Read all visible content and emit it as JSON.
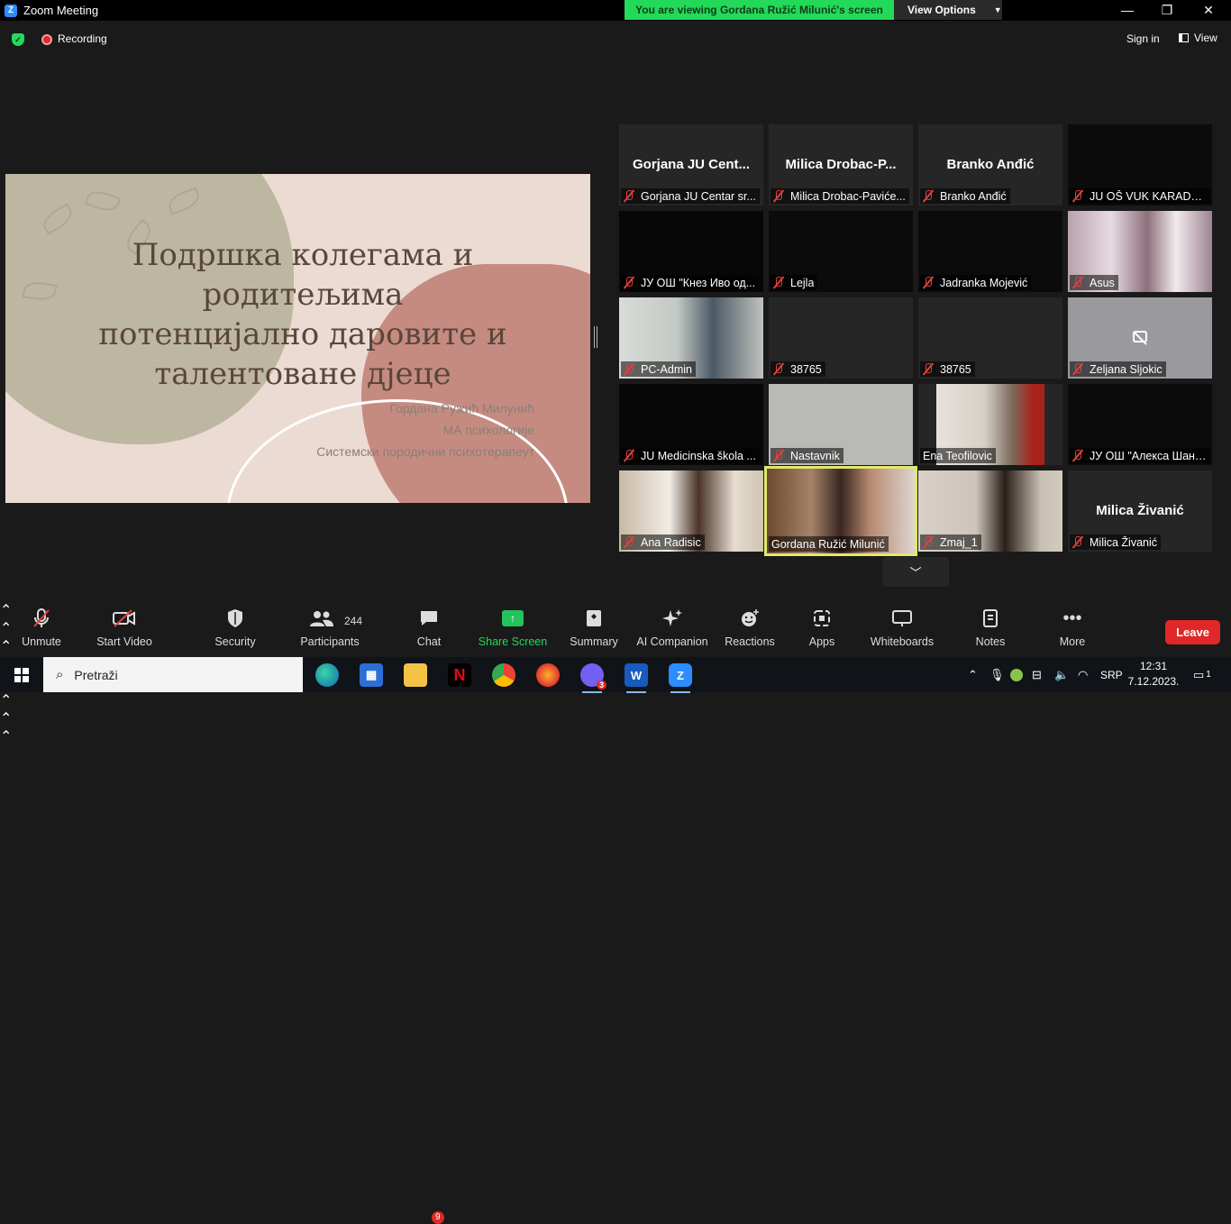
{
  "window": {
    "app_title": "Zoom Meeting",
    "viewing_banner": "You are viewing Gordana Ružić Milunić's screen",
    "view_options_label": "View Options",
    "minimize": "—",
    "restore": "❐",
    "close": "✕"
  },
  "topbar": {
    "recording_label": "Recording",
    "signin_label": "Sign in",
    "view_label": "View"
  },
  "slide": {
    "title_lines": [
      "Подршка колегама и",
      "родитељима",
      "потенцијално даровите и",
      "талентоване дјеце"
    ],
    "author": "Гордана Ружић Милунић",
    "degree": "МА психологије",
    "role": "Системски породични психотерапеут"
  },
  "gallery": [
    {
      "name": "Gorjana  JU  Cent...",
      "label": "Gorjana JU Centar sr..."
    },
    {
      "name": "Milica  Drobac-P...",
      "label": "Milica Drobac-Paviće..."
    },
    {
      "name": "Branko Anđić",
      "label": "Branko Anđić"
    },
    {
      "name": "",
      "label": "JU OŠ VUK KARADŽI..."
    },
    {
      "name": "",
      "label": "ЈУ ОШ \"Кнез Иво од..."
    },
    {
      "name": "",
      "label": "Lejla"
    },
    {
      "name": "",
      "label": "Jadranka Mojević"
    },
    {
      "name": "",
      "label": "Asus"
    },
    {
      "name": "",
      "label": "PC-Admin"
    },
    {
      "name": "",
      "label": "38765"
    },
    {
      "name": "",
      "label": "38765"
    },
    {
      "name": "",
      "label": "Zeljana Sljokic"
    },
    {
      "name": "",
      "label": "JU Medicinska škola ..."
    },
    {
      "name": "",
      "label": "Nastavnik"
    },
    {
      "name": "",
      "label": "Ena Teofilovic"
    },
    {
      "name": "",
      "label": "ЈУ ОШ \"Алекса Шант..."
    },
    {
      "name": "",
      "label": "Ana Radisic"
    },
    {
      "name": "",
      "label": "Gordana Ružić Milunić"
    },
    {
      "name": "",
      "label": "Zmaj_1"
    },
    {
      "name": "Milica Živanić",
      "label": "Milica Živanić"
    }
  ],
  "toolbar": {
    "unmute": "Unmute",
    "start_video": "Start Video",
    "security": "Security",
    "participants": "Participants",
    "participants_count": "244",
    "chat": "Chat",
    "chat_badge": "9",
    "share_screen": "Share Screen",
    "summary": "Summary",
    "ai_companion": "AI Companion",
    "reactions": "Reactions",
    "apps": "Apps",
    "whiteboards": "Whiteboards",
    "notes": "Notes",
    "more": "More",
    "leave": "Leave"
  },
  "taskbar": {
    "search_placeholder": "Pretraži",
    "language": "SRP",
    "time": "12:31",
    "date": "7.12.2023.",
    "viber_badge": "3",
    "notification_count": "1"
  },
  "colors": {
    "accent_green": "#23d959",
    "leave_red": "#e02828",
    "active_speaker": "#e3e86b",
    "zoom_blue": "#2d8cff"
  }
}
